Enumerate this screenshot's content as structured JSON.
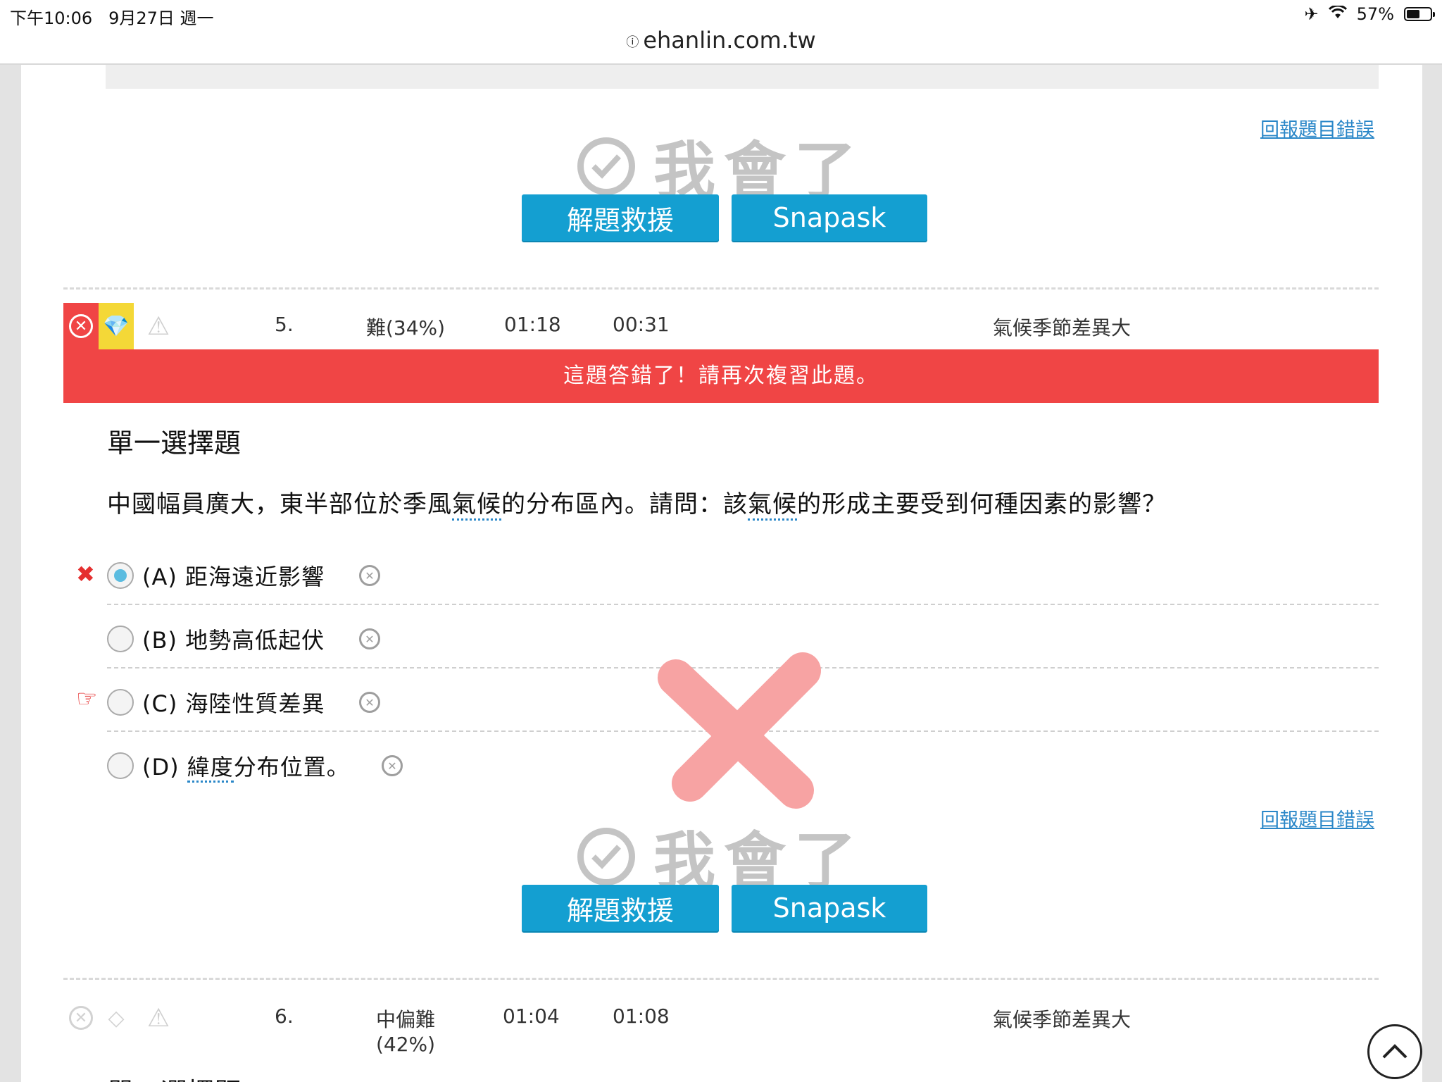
{
  "status_bar": {
    "time": "下午10:06",
    "date": "9月27日 週一",
    "battery": "57%",
    "battery_level": 0.57,
    "airplane_icon": "airplane-icon",
    "wifi_icon": "wifi-icon"
  },
  "browser": {
    "url": "ehanlin.com.tw"
  },
  "section1": {
    "report_link": "回報題目錯誤",
    "learned_label": "我會了",
    "help_button": "解題救援",
    "snapask_button": "Snapask"
  },
  "question5": {
    "number": "5.",
    "difficulty": "難(34%)",
    "time_used": "01:18",
    "time_avg": "00:31",
    "topic": "氣候季節差異大",
    "wrong_banner": "這題答錯了！請再次複習此題。",
    "type": "單一選擇題",
    "text_parts": [
      "中國幅員廣大，東半部位於季風",
      "氣候",
      "的分布區內。請問：該",
      "氣候",
      "的形成主要受到何種因素的影響？"
    ],
    "options": [
      {
        "label": "(A) 距海遠近影響",
        "selected": true,
        "marker": "wrong"
      },
      {
        "label": "(B) 地勢高低起伏",
        "selected": false,
        "marker": ""
      },
      {
        "label": "(C) 海陸性質差異",
        "selected": false,
        "marker": "correct"
      },
      {
        "label_parts": [
          "(D) ",
          "緯度",
          "分布位置。"
        ],
        "selected": false,
        "marker": ""
      }
    ],
    "report_link": "回報題目錯誤",
    "learned_label": "我會了",
    "help_button": "解題救援",
    "snapask_button": "Snapask"
  },
  "question6": {
    "number": "6.",
    "difficulty_line1": "中偏難",
    "difficulty_line2": "(42%)",
    "time_used": "01:04",
    "time_avg": "01:08",
    "topic": "氣候季節差異大",
    "type": "單一選擇題"
  },
  "colors": {
    "accent_blue": "#149fd1",
    "wrong_red": "#f04545",
    "diamond_yellow": "#f4d837",
    "link_blue": "#2a87c8"
  }
}
